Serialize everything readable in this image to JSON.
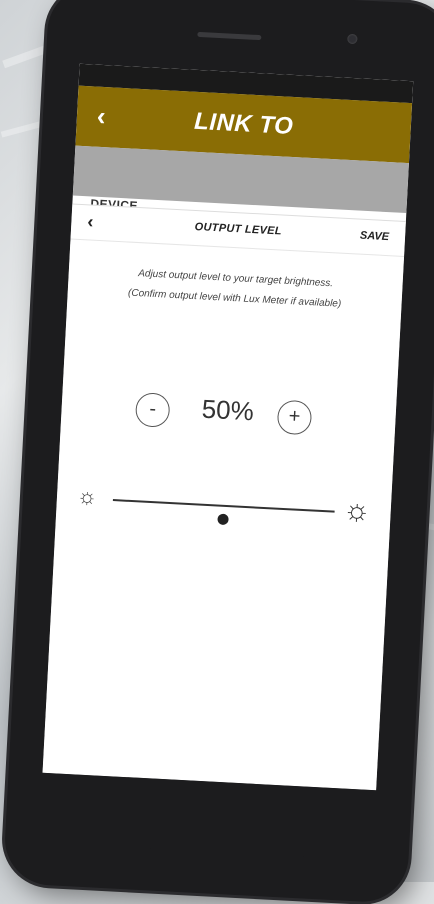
{
  "header": {
    "back_icon": "chevron-left-icon",
    "title": "LINK TO"
  },
  "device_label": "DEVICE",
  "sheet": {
    "title": "OUTPUT LEVEL",
    "save_label": "SAVE",
    "back_icon": "chevron-left-icon"
  },
  "instructions": {
    "line1": "Adjust output level to your target brightness.",
    "line2": "(Confirm output level with Lux Meter if available)"
  },
  "output_level": {
    "minus_label": "-",
    "plus_label": "+",
    "value_text": "50%",
    "value": 50
  },
  "slider": {
    "value": 0.5,
    "min_icon": "sun-dim-icon",
    "max_icon": "sun-bright-icon"
  },
  "colors": {
    "header_bg": "#8a6d05",
    "band_bg": "#a7a7a7"
  }
}
